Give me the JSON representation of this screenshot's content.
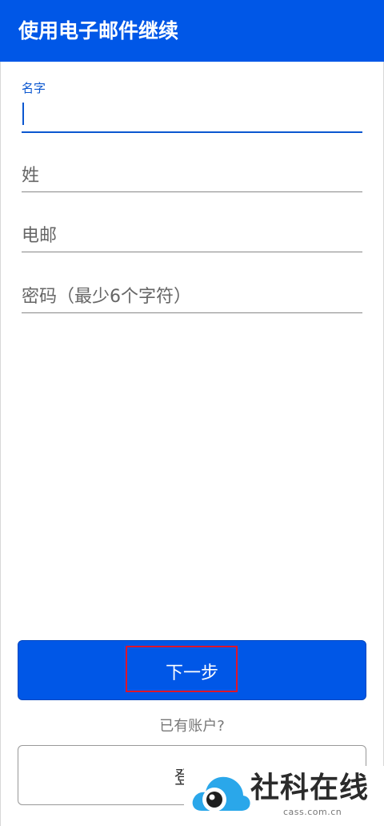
{
  "header": {
    "title": "使用电子邮件继续"
  },
  "form": {
    "name_label": "名字",
    "name_value": "",
    "surname_placeholder": "姓",
    "email_placeholder": "电邮",
    "password_placeholder": "密码（最少6个字符）"
  },
  "actions": {
    "next_label": "下一步",
    "has_account_text": "已有账户?",
    "login_label": "登录"
  },
  "watermark": {
    "name": "社科在线",
    "domain": "cass.com.cn"
  },
  "colors": {
    "accent": "#0057e7",
    "highlight": "#e0152a"
  }
}
